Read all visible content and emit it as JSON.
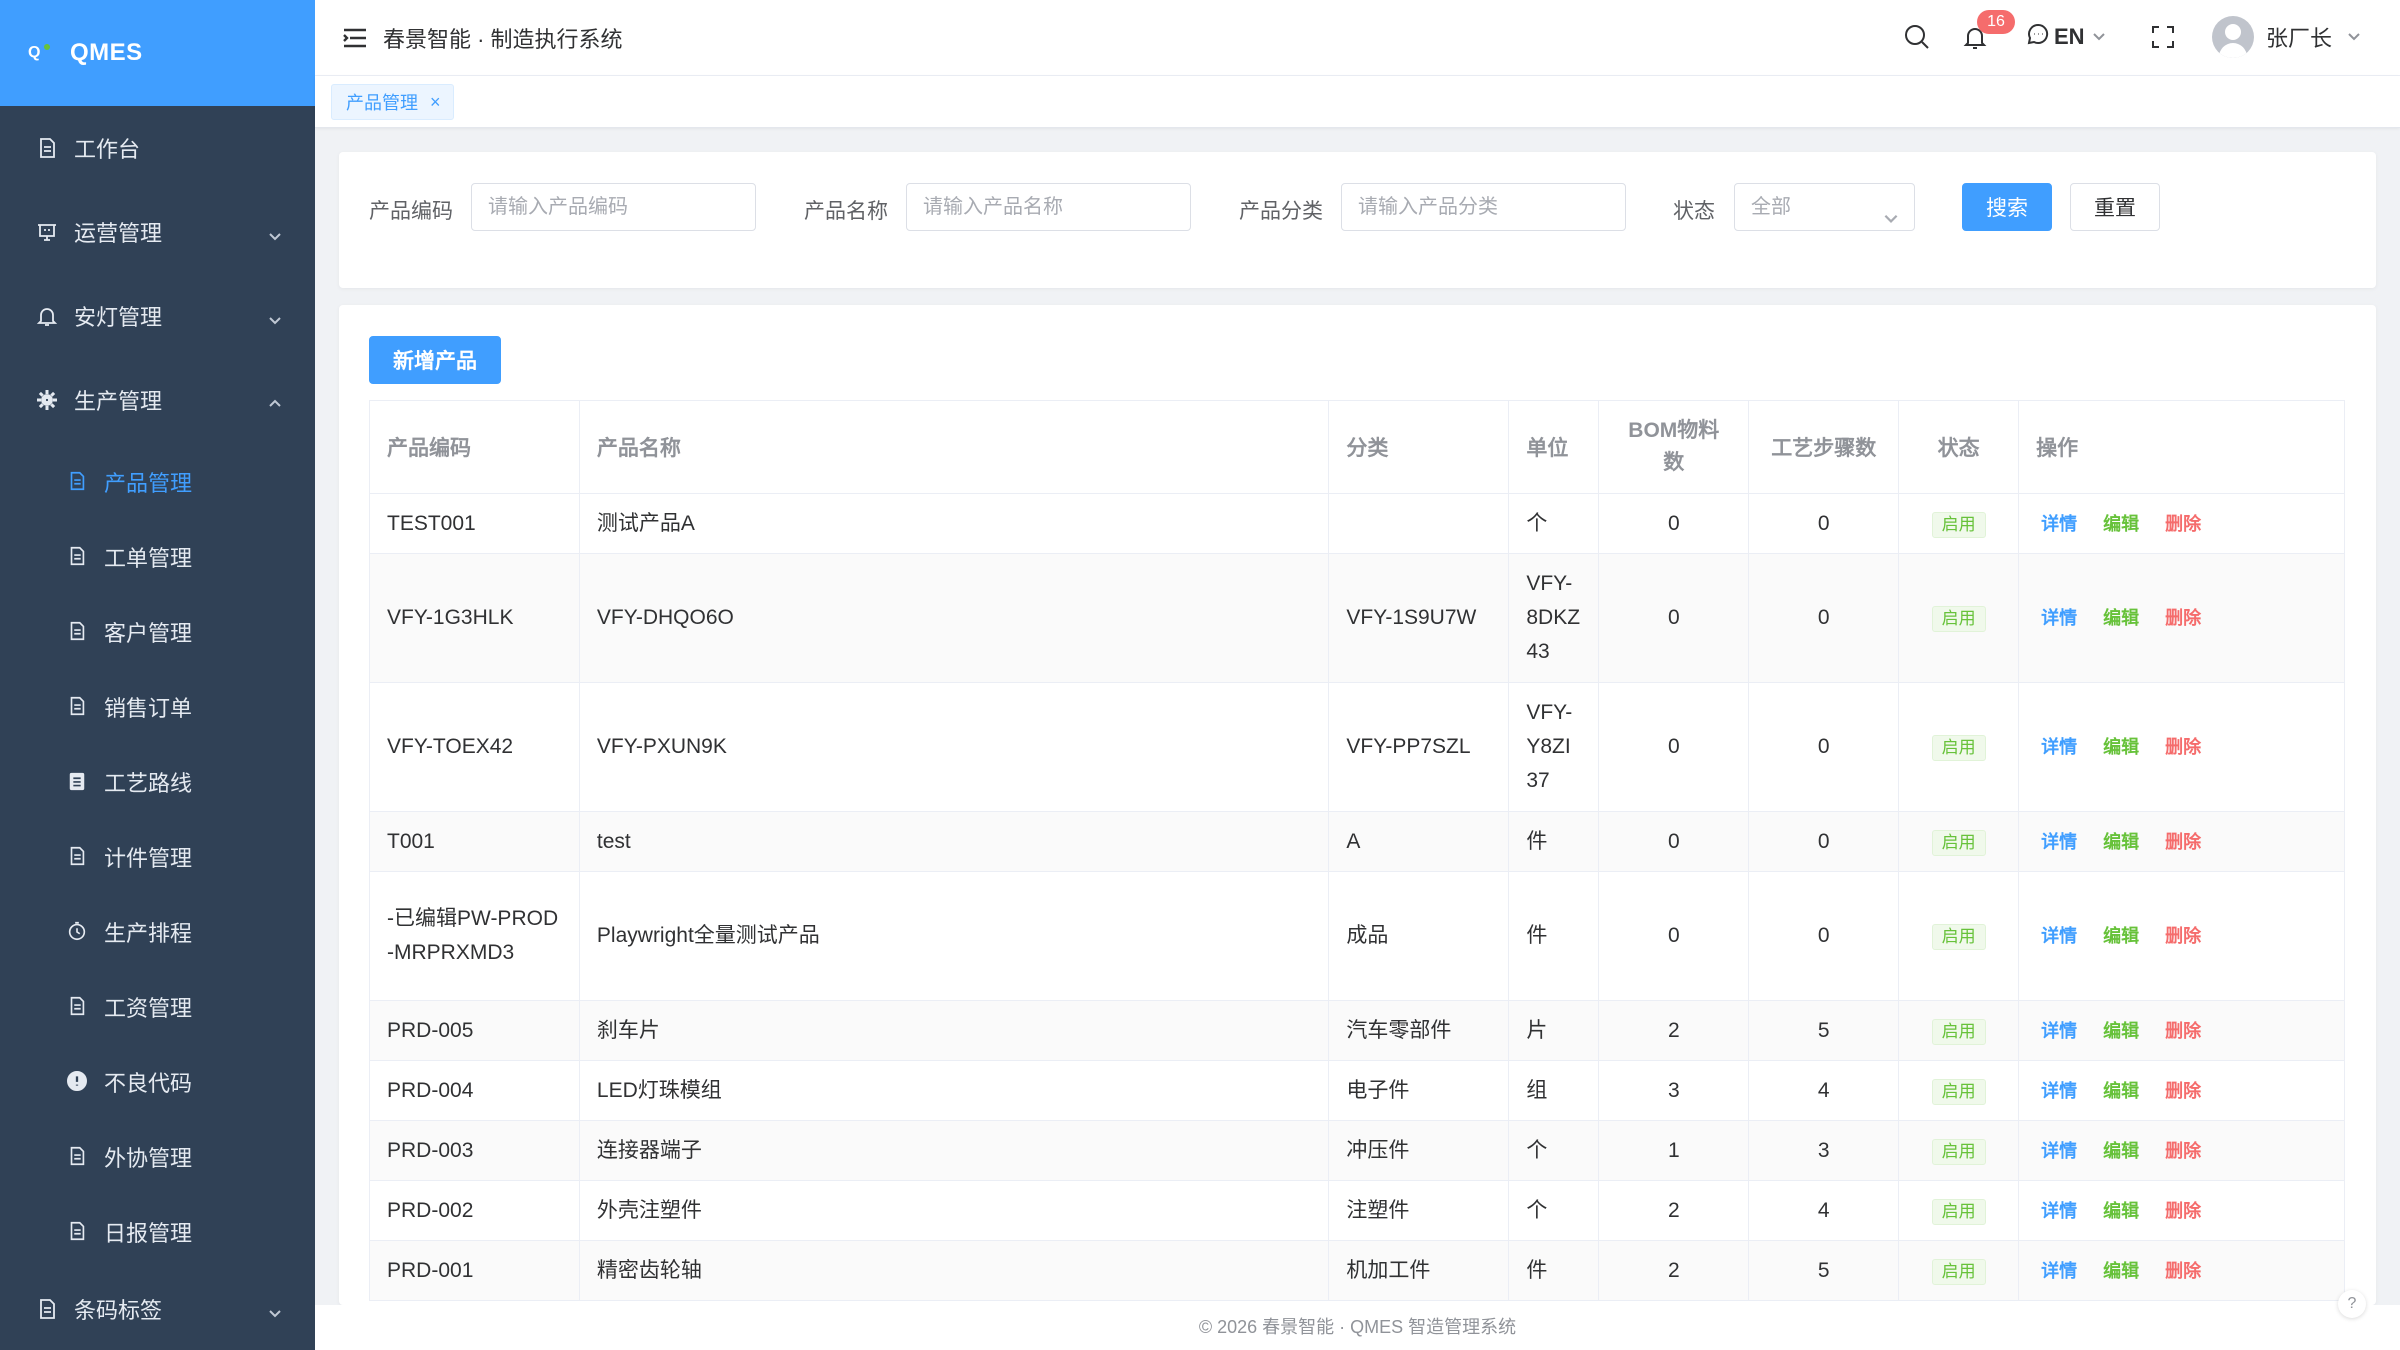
{
  "app": {
    "logo_mark": "Q",
    "logo_text": "QMES",
    "title": "春景智能 · 制造执行系统"
  },
  "header": {
    "notification_count": "16",
    "language": "EN",
    "user_name": "张厂长"
  },
  "sidebar": {
    "items": [
      {
        "label": "工作台",
        "icon": "document-icon"
      },
      {
        "label": "运营管理",
        "icon": "presentation-icon",
        "expanded": false
      },
      {
        "label": "安灯管理",
        "icon": "bell-icon",
        "expanded": false
      },
      {
        "label": "生产管理",
        "icon": "gear-icon",
        "expanded": true
      }
    ],
    "sub_items": [
      {
        "label": "产品管理",
        "icon": "document-icon",
        "active": true
      },
      {
        "label": "工单管理",
        "icon": "document-icon"
      },
      {
        "label": "客户管理",
        "icon": "document-icon"
      },
      {
        "label": "销售订单",
        "icon": "document-icon"
      },
      {
        "label": "工艺路线",
        "icon": "clipboard-icon"
      },
      {
        "label": "计件管理",
        "icon": "document-icon"
      },
      {
        "label": "生产排程",
        "icon": "stopwatch-icon"
      },
      {
        "label": "工资管理",
        "icon": "document-icon"
      },
      {
        "label": "不良代码",
        "icon": "warning-circle-icon"
      },
      {
        "label": "外协管理",
        "icon": "document-icon"
      },
      {
        "label": "日报管理",
        "icon": "document-icon"
      }
    ],
    "bottom_item": {
      "label": "条码标签",
      "icon": "document-icon",
      "expanded": false
    }
  },
  "tabs": [
    {
      "label": "产品管理",
      "close": "×"
    }
  ],
  "filters": {
    "code_label": "产品编码",
    "code_placeholder": "请输入产品编码",
    "name_label": "产品名称",
    "name_placeholder": "请输入产品名称",
    "category_label": "产品分类",
    "category_placeholder": "请输入产品分类",
    "status_label": "状态",
    "status_value": "全部",
    "search_button": "搜索",
    "reset_button": "重置"
  },
  "table": {
    "add_button": "新增产品",
    "headers": [
      "产品编码",
      "产品名称",
      "分类",
      "单位",
      "BOM物料数",
      "工艺步骤数",
      "状态",
      "操作"
    ],
    "actions": {
      "detail": "详情",
      "edit": "编辑",
      "delete": "删除"
    },
    "rows": [
      {
        "code": "TEST001",
        "name": "测试产品A",
        "category": "",
        "unit": "个",
        "bom": "0",
        "steps": "0",
        "status": "启用"
      },
      {
        "code": "VFY-1G3HLK",
        "name": "VFY-DHQO6O",
        "category": "VFY-1S9U7W",
        "unit": "VFY-8DKZ43",
        "bom": "0",
        "steps": "0",
        "status": "启用"
      },
      {
        "code": "VFY-TOEX42",
        "name": "VFY-PXUN9K",
        "category": "VFY-PP7SZL",
        "unit": "VFY-Y8ZI37",
        "bom": "0",
        "steps": "0",
        "status": "启用"
      },
      {
        "code": "T001",
        "name": "test",
        "category": "A",
        "unit": "件",
        "bom": "0",
        "steps": "0",
        "status": "启用"
      },
      {
        "code": "-已编辑PW-PROD-MRPRXMD3",
        "name": "Playwright全量测试产品",
        "category": "成品",
        "unit": "件",
        "bom": "0",
        "steps": "0",
        "status": "启用"
      },
      {
        "code": "PRD-005",
        "name": "刹车片",
        "category": "汽车零部件",
        "unit": "片",
        "bom": "2",
        "steps": "5",
        "status": "启用"
      },
      {
        "code": "PRD-004",
        "name": "LED灯珠模组",
        "category": "电子件",
        "unit": "组",
        "bom": "3",
        "steps": "4",
        "status": "启用"
      },
      {
        "code": "PRD-003",
        "name": "连接器端子",
        "category": "冲压件",
        "unit": "个",
        "bom": "1",
        "steps": "3",
        "status": "启用"
      },
      {
        "code": "PRD-002",
        "name": "外壳注塑件",
        "category": "注塑件",
        "unit": "个",
        "bom": "2",
        "steps": "4",
        "status": "启用"
      },
      {
        "code": "PRD-001",
        "name": "精密齿轮轴",
        "category": "机加工件",
        "unit": "件",
        "bom": "2",
        "steps": "5",
        "status": "启用"
      }
    ]
  },
  "footer": {
    "text": "© 2026 春景智能 · QMES 智造管理系统"
  },
  "colors": {
    "primary": "#409eff",
    "sidebar_bg": "#304156",
    "success": "#67c23a",
    "danger": "#f56c6c"
  }
}
